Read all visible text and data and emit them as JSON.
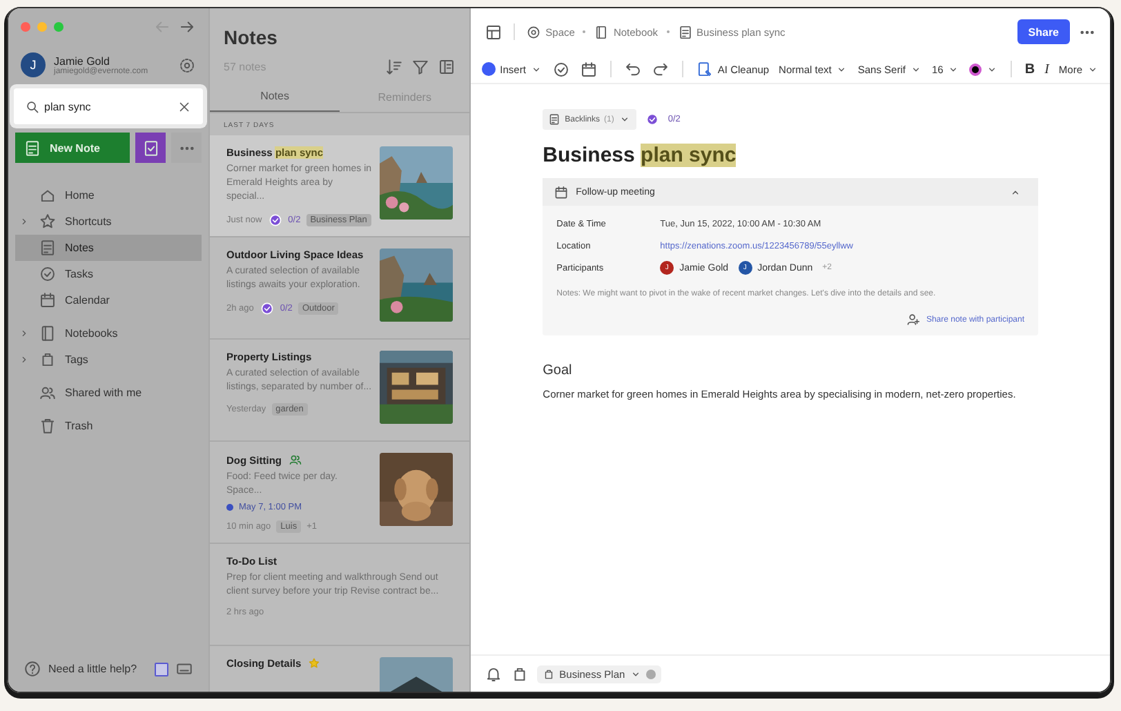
{
  "sidebar": {
    "user": {
      "initial": "J",
      "name": "Jamie Gold",
      "email": "jamiegold@evernote.com"
    },
    "search": {
      "value": "plan sync"
    },
    "new_note": "New Note",
    "nav": [
      {
        "label": "Home",
        "expandable": false,
        "selected": false
      },
      {
        "label": "Shortcuts",
        "expandable": true,
        "selected": false
      },
      {
        "label": "Notes",
        "expandable": false,
        "selected": true
      },
      {
        "label": "Tasks",
        "expandable": false,
        "selected": false
      },
      {
        "label": "Calendar",
        "expandable": false,
        "selected": false
      },
      {
        "label": "Notebooks",
        "expandable": true,
        "selected": false
      },
      {
        "label": "Tags",
        "expandable": true,
        "selected": false
      },
      {
        "label": "Shared with me",
        "expandable": false,
        "selected": false
      },
      {
        "label": "Trash",
        "expandable": false,
        "selected": false
      }
    ],
    "help": "Need a little help?"
  },
  "notes_list": {
    "title": "Notes",
    "count": "57 notes",
    "tabs": [
      {
        "label": "Notes",
        "selected": true
      },
      {
        "label": "Reminders",
        "selected": false
      }
    ],
    "section": "LAST 7 DAYS",
    "notes": [
      {
        "title": [
          {
            "text": "Business ",
            "match": false
          },
          {
            "text": "plan sync",
            "match": true
          }
        ],
        "snippet": "Corner market for green homes in Emerald Heights area by special...",
        "time": "Just now",
        "tasks": "0/2",
        "tags": [
          "Business Plan"
        ],
        "shared": false,
        "starred": false,
        "selected": true,
        "thumbnail": {
          "kind": "picture"
        }
      },
      {
        "title": [
          {
            "text": "Outdoor Living Space Ideas",
            "match": false
          }
        ],
        "snippet": "A curated selection of available listings awaits your exploration.",
        "time": "2h ago",
        "tasks": "0/2",
        "tags": [
          "Outdoor"
        ],
        "shared": false,
        "starred": false,
        "selected": false,
        "thumbnail": {
          "kind": "picture"
        }
      },
      {
        "title": [
          {
            "text": "Property Listings",
            "match": false
          }
        ],
        "snippet": "A curated selection of available listings, separated by number of...",
        "time": "Yesterday",
        "tags": [
          "garden"
        ],
        "shared": false,
        "starred": false,
        "selected": false,
        "thumbnail": {
          "kind": "picture"
        }
      },
      {
        "title": [
          {
            "text": "Dog Sitting",
            "match": false
          }
        ],
        "snippet": "Food: Feed twice per day. Space...",
        "reminder": "May 7, 1:00 PM",
        "time": "10 min ago",
        "tags": [
          "Luis"
        ],
        "more_tags": "+1",
        "shared": true,
        "starred": false,
        "selected": false,
        "thumbnail": {
          "kind": "picture"
        }
      },
      {
        "title": [
          {
            "text": "To-Do List",
            "match": false
          }
        ],
        "snippet": "Prep for client meeting and walkthrough Send out client survey before your trip Revise contract be...",
        "time": "2 hrs ago",
        "shared": false,
        "starred": false,
        "selected": false
      },
      {
        "title": [
          {
            "text": "Closing Details",
            "match": false
          }
        ],
        "shared": false,
        "starred": true,
        "selected": false,
        "thumbnail": {
          "kind": "picture"
        }
      }
    ]
  },
  "editor": {
    "breadcrumb": [
      "Space",
      "Notebook",
      "Business plan sync"
    ],
    "share": "Share",
    "toolbar": [
      {
        "kind": "menu",
        "label": "Insert"
      },
      {
        "kind": "icon"
      },
      {
        "kind": "icon"
      },
      {
        "kind": "divider"
      },
      {
        "kind": "icon"
      },
      {
        "kind": "icon"
      },
      {
        "kind": "divider"
      },
      {
        "kind": "ai",
        "label": "AI Cleanup"
      },
      {
        "kind": "menu",
        "label": "Normal text"
      },
      {
        "kind": "menu",
        "label": "Sans Serif"
      },
      {
        "kind": "menu",
        "label": "16"
      },
      {
        "kind": "color",
        "color": "#000000"
      },
      {
        "kind": "divider"
      },
      {
        "kind": "bold",
        "label": "B"
      },
      {
        "kind": "italic",
        "label": "I"
      },
      {
        "kind": "menu",
        "label": "More"
      }
    ],
    "backlinks": {
      "label": "Backlinks",
      "count": "(1)"
    },
    "tasks": "0/2",
    "title": [
      {
        "text": "Business ",
        "match": false
      },
      {
        "text": "plan sync",
        "match": true
      }
    ],
    "meeting": {
      "title": "Follow-up meeting",
      "expanded": true,
      "rows": [
        {
          "kind": "text",
          "label": "Date & Time",
          "value": "Tue, Jun 15, 2022, 10:00 AM - 10:30 AM"
        },
        {
          "kind": "link",
          "label": "Location",
          "value": "https://zenations.zoom.us/1223456789/55eyllww"
        },
        {
          "kind": "people",
          "label": "Participants",
          "people": [
            {
              "initial": "J",
              "name": "Jamie Gold",
              "color": "#b3261e"
            },
            {
              "initial": "J",
              "name": "Jordan Dunn",
              "color": "#2456a6"
            }
          ],
          "more": "+2"
        }
      ],
      "notes": "Notes: We might want to pivot in the wake of recent market changes. Let's dive into the details and see.",
      "share_link": "Share note with participant"
    },
    "heading": "Goal",
    "body": "Corner market for green homes in Emerald Heights area by specialising in modern, net-zero properties.",
    "footer_tag": "Business Plan"
  }
}
